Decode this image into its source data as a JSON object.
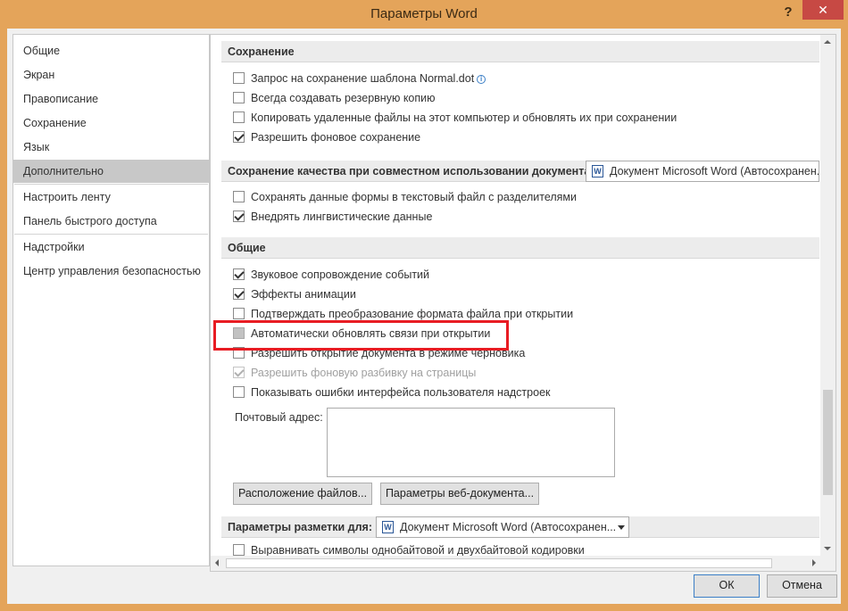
{
  "window": {
    "title": "Параметры Word",
    "help_label": "?",
    "close_label": "✕"
  },
  "sidebar": {
    "items": [
      {
        "label": "Общие"
      },
      {
        "label": "Экран"
      },
      {
        "label": "Правописание"
      },
      {
        "label": "Сохранение"
      },
      {
        "label": "Язык"
      },
      {
        "label": "Дополнительно",
        "selected": true
      },
      {
        "label": "Настроить ленту"
      },
      {
        "label": "Панель быстрого доступа"
      },
      {
        "label": "Надстройки"
      },
      {
        "label": "Центр управления безопасностью"
      }
    ]
  },
  "sections": {
    "save": {
      "title": "Сохранение",
      "options": [
        {
          "label": "Запрос на сохранение шаблона Normal.dot",
          "checked": false
        },
        {
          "label": "Всегда создавать резервную копию",
          "checked": false
        },
        {
          "label": "Копировать удаленные файлы на этот компьютер и обновлять их при сохранении",
          "checked": false
        },
        {
          "label": "Разрешить фоновое сохранение",
          "checked": true
        }
      ]
    },
    "fidelity": {
      "title": "Сохранение качества при совместном использовании документа:",
      "document": "Документ Microsoft Word (Автосохранен...",
      "options": [
        {
          "label": "Сохранять данные формы в текстовый файл с разделителями",
          "checked": false
        },
        {
          "label": "Внедрять лингвистические данные",
          "checked": true
        }
      ]
    },
    "general": {
      "title": "Общие",
      "options": [
        {
          "label": "Звуковое сопровождение событий",
          "checked": true
        },
        {
          "label": "Эффекты анимации",
          "checked": true
        },
        {
          "label": "Подтверждать преобразование формата файла при открытии",
          "checked": false
        },
        {
          "label": "Автоматически обновлять связи при открытии",
          "checked": false,
          "highlighted": true
        },
        {
          "label": "Разрешить открытие документа в режиме черновика",
          "checked": false
        },
        {
          "label": "Разрешить фоновую разбивку на страницы",
          "checked": true,
          "disabled": true
        },
        {
          "label": "Показывать ошибки интерфейса пользователя надстроек",
          "checked": false
        }
      ],
      "mail_label": "Почтовый адрес:",
      "mail_value": "",
      "file_locations_button": "Расположение файлов...",
      "web_options_button": "Параметры веб-документа..."
    },
    "layout": {
      "title": "Параметры разметки для:",
      "document": "Документ Microsoft Word (Автосохранен...",
      "options": [
        {
          "label": "Выравнивать символы однобайтовой и двухбайтовой кодировки",
          "checked": false
        }
      ]
    }
  },
  "footer": {
    "ok_label": "ОК",
    "cancel_label": "Отмена"
  },
  "colors": {
    "window_frame": "#e4a45a",
    "close_button": "#c74944",
    "highlight_box": "#e81c23",
    "selected_nav": "#c8c8c8"
  }
}
